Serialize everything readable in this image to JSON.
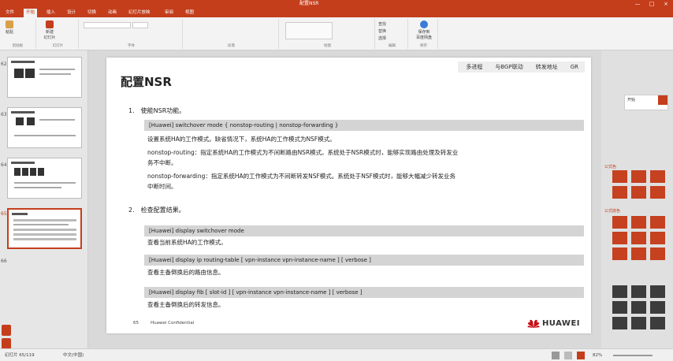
{
  "window": {
    "title": "配置NSR",
    "controls": [
      "—",
      "□",
      "×"
    ]
  },
  "ribbon_tabs": [
    {
      "label": "文件",
      "active": false
    },
    {
      "label": "开始",
      "active": true
    },
    {
      "label": "插入",
      "active": false
    },
    {
      "label": "设计",
      "active": false
    },
    {
      "label": "切换",
      "active": false
    },
    {
      "label": "动画",
      "active": false
    },
    {
      "label": "幻灯片放映",
      "active": false
    },
    {
      "label": "审阅",
      "active": false
    },
    {
      "label": "视图",
      "active": false
    }
  ],
  "ribbon": {
    "groups": [
      "剪贴板",
      "幻灯片",
      "字体",
      "段落",
      "绘图",
      "编辑",
      "保存"
    ],
    "buttons": {
      "paste": "粘贴",
      "new_slide": "新建\n幻灯片",
      "find": "查找",
      "replace": "替换",
      "select": "选择",
      "save_to": "保存到\n百度网盘"
    }
  },
  "thumbnails": [
    {
      "num": "62",
      "selected": false
    },
    {
      "num": "63",
      "selected": false
    },
    {
      "num": "64",
      "selected": false
    },
    {
      "num": "65",
      "selected": true
    },
    {
      "num": "66",
      "selected": false
    }
  ],
  "slide": {
    "nav": [
      "多进程",
      "与BGP联动",
      "转发地址",
      "GR"
    ],
    "title": "配置NSR",
    "section1": "1.　使能NSR功能。",
    "cmd1": "[Huawei] switchover mode { nonstop-routing | nonstop-forwarding }",
    "para1": [
      "设置系统HA的工作模式。缺省情况下，系统HA的工作模式为NSF模式。",
      "nonstop-routing：指定系统HA的工作模式为不间断路由NSR模式。系统处于NSR模式时，能够实现路由处理及转发业",
      "务不中断。",
      "nonstop-forwarding：指定系统HA的工作模式为不间断转发NSF模式。系统处于NSF模式时，能够大幅减少转发业务",
      "中断时间。"
    ],
    "section2": "2.　检查配置结果。",
    "cmd2": "[Huawei] display switchover mode",
    "para2": "查看当前系统HA的工作模式。",
    "cmd3": "[Huawei] display ip routing-table [ vpn-instance vpn-instance-name ] [ verbose ]",
    "para3": "查看主备倒换后的路由信息。",
    "cmd4": "[Huawei] display fib [ slot-id ] [ vpn-instance vpn-instance-name ] [ verbose ]",
    "para4": "查看主备倒换后的转发信息。",
    "footer_num": "65",
    "footer_conf": "Huawei Confidential",
    "logo": "HUAWEI"
  },
  "right_panel": {
    "note": "开始",
    "label1": "公式色",
    "label2": "公式底色"
  },
  "statusbar": {
    "slide_info": "幻灯片 65/119",
    "language": "中文(中国)",
    "zoom": "82%"
  },
  "colors": {
    "accent": "#c43e1c",
    "cmd_bg": "#d4d4d4"
  }
}
